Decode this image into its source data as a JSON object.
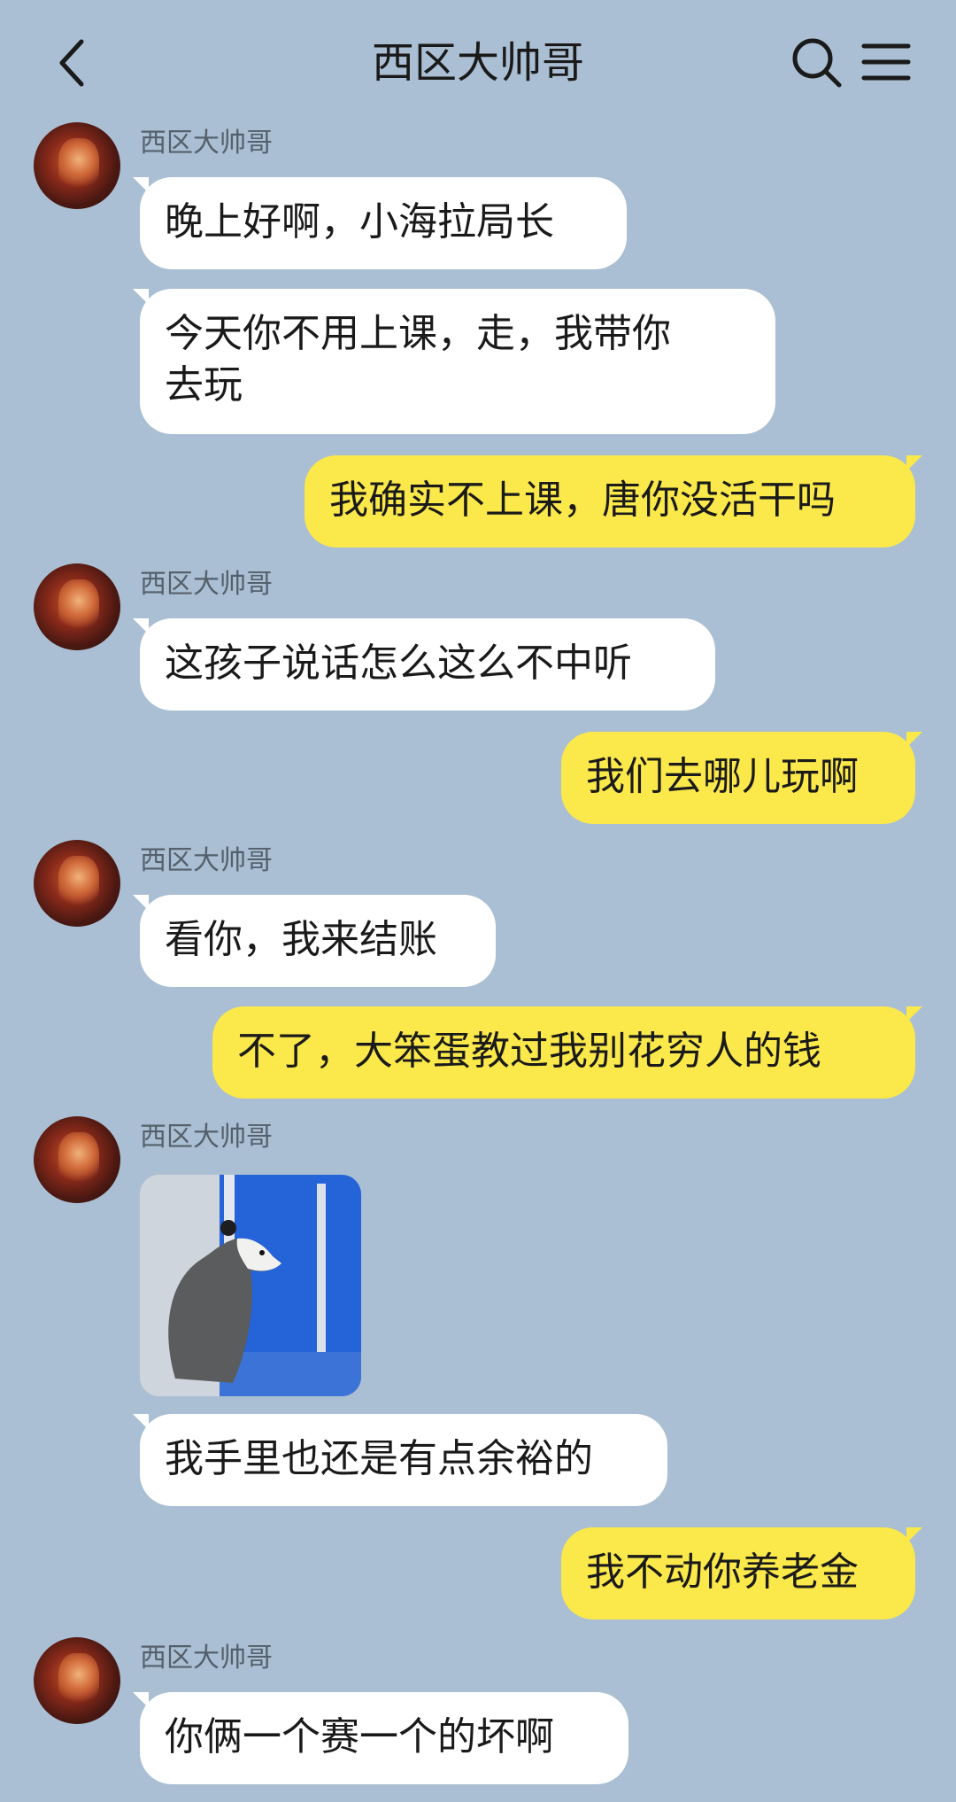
{
  "header": {
    "title": "西区大帅哥",
    "back_icon": "chevron-left-icon",
    "search_icon": "search-icon",
    "menu_icon": "menu-icon"
  },
  "colors": {
    "background": "#aabfd3",
    "incoming_bubble": "#ffffff",
    "outgoing_bubble": "#fbe84a"
  },
  "messages": [
    {
      "sender": "西区大帅哥",
      "text": "晚上好啊，小海拉局长"
    },
    {
      "text": "今天你不用上课，走，我带你\n去玩"
    },
    {
      "text": "我确实不上课，唐你没活干吗"
    },
    {
      "sender": "西区大帅哥",
      "text": "这孩子说话怎么这么不中听"
    },
    {
      "text": "我们去哪儿玩啊"
    },
    {
      "sender": "西区大帅哥",
      "text": "看你，我来结账"
    },
    {
      "text": "不了，大笨蛋教过我别花穷人的钱"
    },
    {
      "sender": "西区大帅哥",
      "sticker": "opossum-at-window-sticker"
    },
    {
      "text": "我手里也还是有点余裕的"
    },
    {
      "text": "我不动你养老金"
    },
    {
      "sender": "西区大帅哥",
      "text": "你俩一个赛一个的坏啊"
    }
  ]
}
